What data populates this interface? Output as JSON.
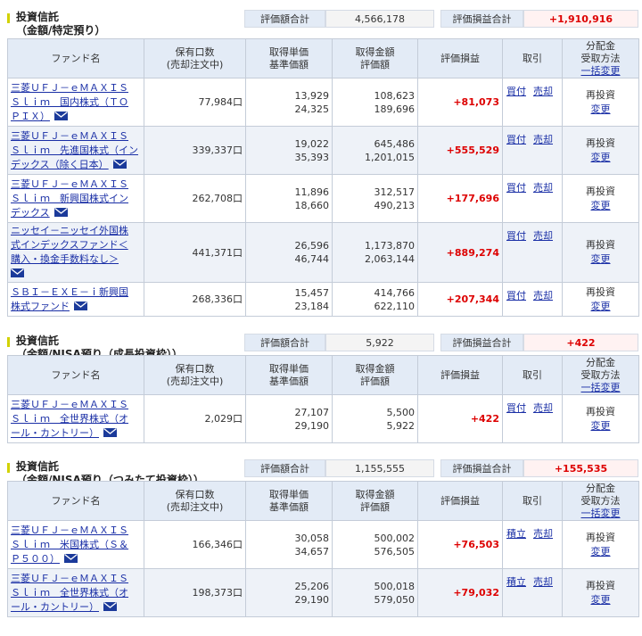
{
  "headers": {
    "fund_name": "ファンド名",
    "holding_1": "保有口数",
    "holding_2": "(売却注文中)",
    "unit_price_1": "取得単価",
    "unit_price_2": "基準価額",
    "amount_1": "取得金額",
    "amount_2": "評価額",
    "gain": "評価損益",
    "trade": "取引",
    "dist_1": "分配金",
    "dist_2": "受取方法",
    "dist_link": "一括変更"
  },
  "labels": {
    "eval_total": "評価額合計",
    "eval_gain_total": "評価損益合計",
    "buy": "買付",
    "sell": "売却",
    "accumulate": "積立",
    "reinvest": "再投資",
    "change": "変更"
  },
  "sections": [
    {
      "title_1": "投資信託",
      "title_2": "（金額/特定預り）",
      "eval_total": "4,566,178",
      "eval_gain_total": "+1,910,916",
      "rows": [
        {
          "name_lines": [
            "三菱ＵＦＪ－ｅＭＡＸＩＳ",
            "Ｓｌｉｍ　国内株式（ＴＯ",
            "ＰＩＸ）"
          ],
          "qty": "77,984口",
          "cost_unit": "13,929",
          "nav": "24,325",
          "cost_amount": "108,623",
          "value": "189,696",
          "gain": "+81,073"
        },
        {
          "name_lines": [
            "三菱ＵＦＪ－ｅＭＡＸＩＳ",
            "Ｓｌｉｍ　先進国株式（イン",
            "デックス（除く日本）"
          ],
          "qty": "339,337口",
          "cost_unit": "19,022",
          "nav": "35,393",
          "cost_amount": "645,486",
          "value": "1,201,015",
          "gain": "+555,529"
        },
        {
          "name_lines": [
            "三菱ＵＦＪ－ｅＭＡＸＩＳ",
            "Ｓｌｉｍ　新興国株式イン",
            "デックス"
          ],
          "qty": "262,708口",
          "cost_unit": "11,896",
          "nav": "18,660",
          "cost_amount": "312,517",
          "value": "490,213",
          "gain": "+177,696"
        },
        {
          "name_lines": [
            "ニッセイ－ニッセイ外国株",
            "式インデックスファンド＜",
            "購入・換金手数料なし＞",
            ""
          ],
          "qty": "441,371口",
          "cost_unit": "26,596",
          "nav": "46,744",
          "cost_amount": "1,173,870",
          "value": "2,063,144",
          "gain": "+889,274"
        },
        {
          "name_lines": [
            "ＳＢＩ－ＥＸＥ－ｉ新興国",
            "株式ファンド"
          ],
          "qty": "268,336口",
          "cost_unit": "15,457",
          "nav": "23,184",
          "cost_amount": "414,766",
          "value": "622,110",
          "gain": "+207,344"
        }
      ]
    },
    {
      "title_1": "投資信託",
      "title_2": "（金額/NISA預り（成長投資枠））",
      "eval_total": "5,922",
      "eval_gain_total": "+422",
      "rows": [
        {
          "name_lines": [
            "三菱ＵＦＪ－ｅＭＡＸＩＳ",
            "Ｓｌｉｍ　全世界株式（オ",
            "ール・カントリー）"
          ],
          "qty": "2,029口",
          "cost_unit": "27,107",
          "nav": "29,190",
          "cost_amount": "5,500",
          "value": "5,922",
          "gain": "+422"
        }
      ]
    },
    {
      "title_1": "投資信託",
      "title_2": "（金額/NISA預り（つみたて投資枠））",
      "eval_total": "1,155,555",
      "eval_gain_total": "+155,535",
      "rows": [
        {
          "name_lines": [
            "三菱ＵＦＪ－ｅＭＡＸＩＳ",
            "Ｓｌｉｍ　米国株式（Ｓ＆",
            "Ｐ５００）"
          ],
          "qty": "166,346口",
          "cost_unit": "30,058",
          "nav": "34,657",
          "cost_amount": "500,002",
          "value": "576,505",
          "gain": "+76,503"
        },
        {
          "name_lines": [
            "三菱ＵＦＪ－ｅＭＡＸＩＳ",
            "Ｓｌｉｍ　全世界株式（オ",
            "ール・カントリー）"
          ],
          "qty": "198,373口",
          "cost_unit": "25,206",
          "nav": "29,190",
          "cost_amount": "500,018",
          "value": "579,050",
          "gain": "+79,032"
        }
      ]
    }
  ]
}
